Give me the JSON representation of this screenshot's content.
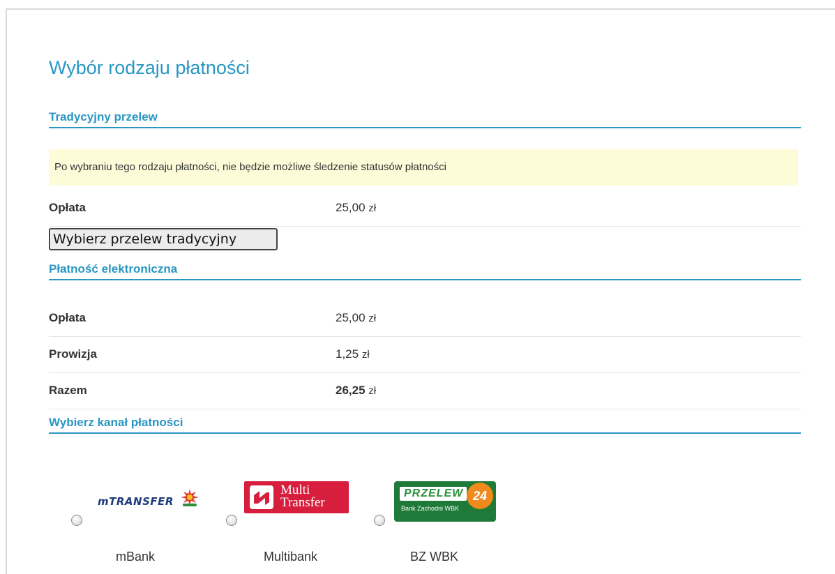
{
  "page": {
    "title": "Wybór rodzaju płatności"
  },
  "traditional": {
    "heading": "Tradycyjny przelew",
    "notice": "Po wybraniu tego rodzaju płatności, nie będzie możliwe śledzenie statusów płatności",
    "fee_label": "Opłata",
    "fee_value": "25,00",
    "currency": "zł",
    "button_label": "Wybierz przelew tradycyjny"
  },
  "electronic": {
    "heading": "Płatność elektroniczna",
    "rows": [
      {
        "label": "Opłata",
        "value": "25,00",
        "currency": "zł",
        "bold": false
      },
      {
        "label": "Prowizja",
        "value": "1,25",
        "currency": "zł",
        "bold": false
      },
      {
        "label": "Razem",
        "value": "26,25",
        "currency": "zł",
        "bold": true
      }
    ]
  },
  "channels": {
    "heading": "Wybierz kanał płatności",
    "options": [
      {
        "name": "mBank",
        "logo_text": "mTRANSFER",
        "logo": "mtransfer-logo",
        "selected": false
      },
      {
        "name": "Multibank",
        "logo_text_line1": "Multi",
        "logo_text_line2": "Transfer",
        "logo": "multitransfer-logo",
        "selected": false
      },
      {
        "name": "BZ WBK",
        "logo_text": "PRZELEW",
        "logo_badge": "24",
        "logo_sub": "Bank Zachodni WBK",
        "logo": "przelew24-logo",
        "selected": false
      }
    ]
  },
  "colors": {
    "accent": "#2a97c3",
    "notice_bg": "#fdfbd8",
    "multitransfer_red": "#d71f3d",
    "bzwbk_green": "#1f7a3a",
    "bzwbk_orange": "#f08a1c"
  }
}
